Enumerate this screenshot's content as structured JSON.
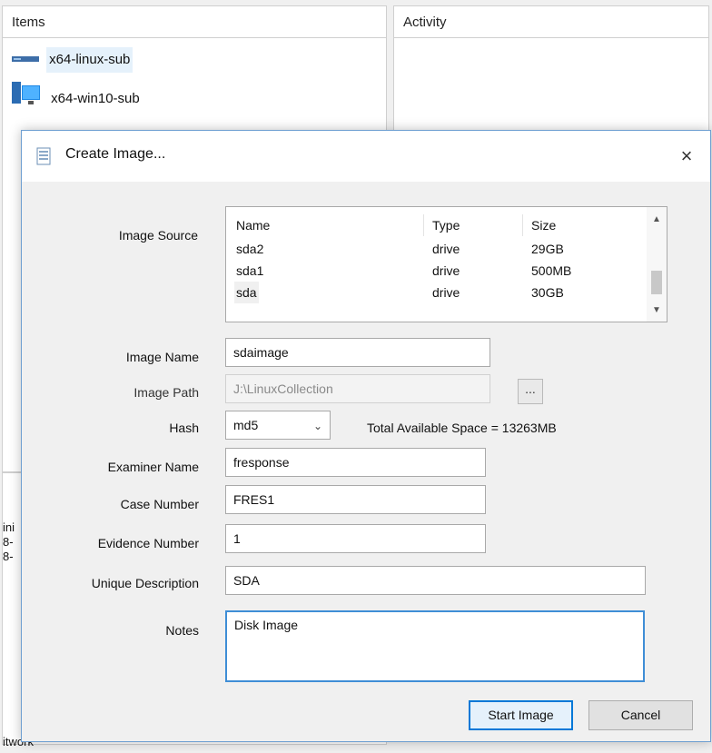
{
  "panes": {
    "items_header": "Items",
    "activity_header": "Activity"
  },
  "tree": [
    {
      "label": "x64-linux-sub",
      "icon": "linux-machine-icon"
    },
    {
      "label": "x64-win10-sub",
      "icon": "windows-machine-icon"
    }
  ],
  "side_fragments": [
    "ini",
    "8-",
    "8-",
    "itwork"
  ],
  "dialog": {
    "title": "Create Image...",
    "close_glyph": "×",
    "labels": {
      "image_source": "Image Source",
      "image_name": "Image Name",
      "image_path": "Image Path",
      "hash": "Hash",
      "examiner_name": "Examiner Name",
      "case_number": "Case Number",
      "evidence_number": "Evidence Number",
      "unique_description": "Unique Description",
      "notes": "Notes"
    },
    "source_list": {
      "columns": [
        "Name",
        "Type",
        "Size"
      ],
      "rows": [
        {
          "name": "sda2",
          "type": "drive",
          "size": "29GB"
        },
        {
          "name": "sda1",
          "type": "drive",
          "size": "500MB"
        },
        {
          "name": "sda",
          "type": "drive",
          "size": "30GB"
        }
      ],
      "selected_index": 2
    },
    "fields": {
      "image_name": "sdaimage",
      "image_path": "J:\\LinuxCollection",
      "hash": "md5",
      "examiner_name": "fresponse",
      "case_number": "FRES1",
      "evidence_number": "1",
      "unique_description": "SDA",
      "notes": "Disk Image"
    },
    "browse_label": "...",
    "space_text": "Total Available Space = 13263MB",
    "buttons": {
      "start": "Start Image",
      "cancel": "Cancel"
    }
  },
  "colors": {
    "accent": "#0078d7",
    "focus_border": "#3f8ed6",
    "dialog_border": "#6e9fd1"
  }
}
